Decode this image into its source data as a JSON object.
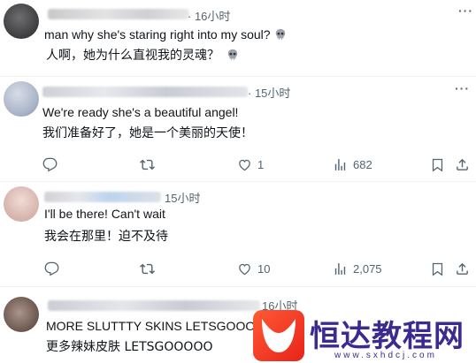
{
  "replies": [
    {
      "time": "· 16小时",
      "text_en": "man why she's staring right into my soul?",
      "text_zh": "人啊，她为什么直视我的灵魂？"
    },
    {
      "time": "· 15小时",
      "text_en": "We're ready she's a beautiful angel!",
      "text_zh": "我们准备好了，她是一个美丽的天使！",
      "likes": "1",
      "views": "682"
    },
    {
      "time": "15小时",
      "text_en": "I'll be there! Can't wait",
      "text_zh": "我会在那里！迫不及待",
      "likes": "10",
      "views": "2,075"
    },
    {
      "time": "16小时",
      "text_en": "MORE SLUTTTY SKINS LETSGOOOOO",
      "text_zh": "更多辣妹皮肤 LETSGOOOOO"
    }
  ],
  "watermark": {
    "title": "恒达教程网",
    "url": "www.sxhdcj.com"
  },
  "icons": {
    "skull": "skull-emoji",
    "more": "more-horizontal-icon",
    "reply": "reply-icon",
    "retweet": "retweet-icon",
    "like": "heart-icon",
    "views": "analytics-icon",
    "bookmark": "bookmark-icon",
    "share": "share-icon"
  },
  "colors": {
    "text": "#0f1419",
    "secondary": "#536471",
    "divider": "#eff3f4"
  }
}
